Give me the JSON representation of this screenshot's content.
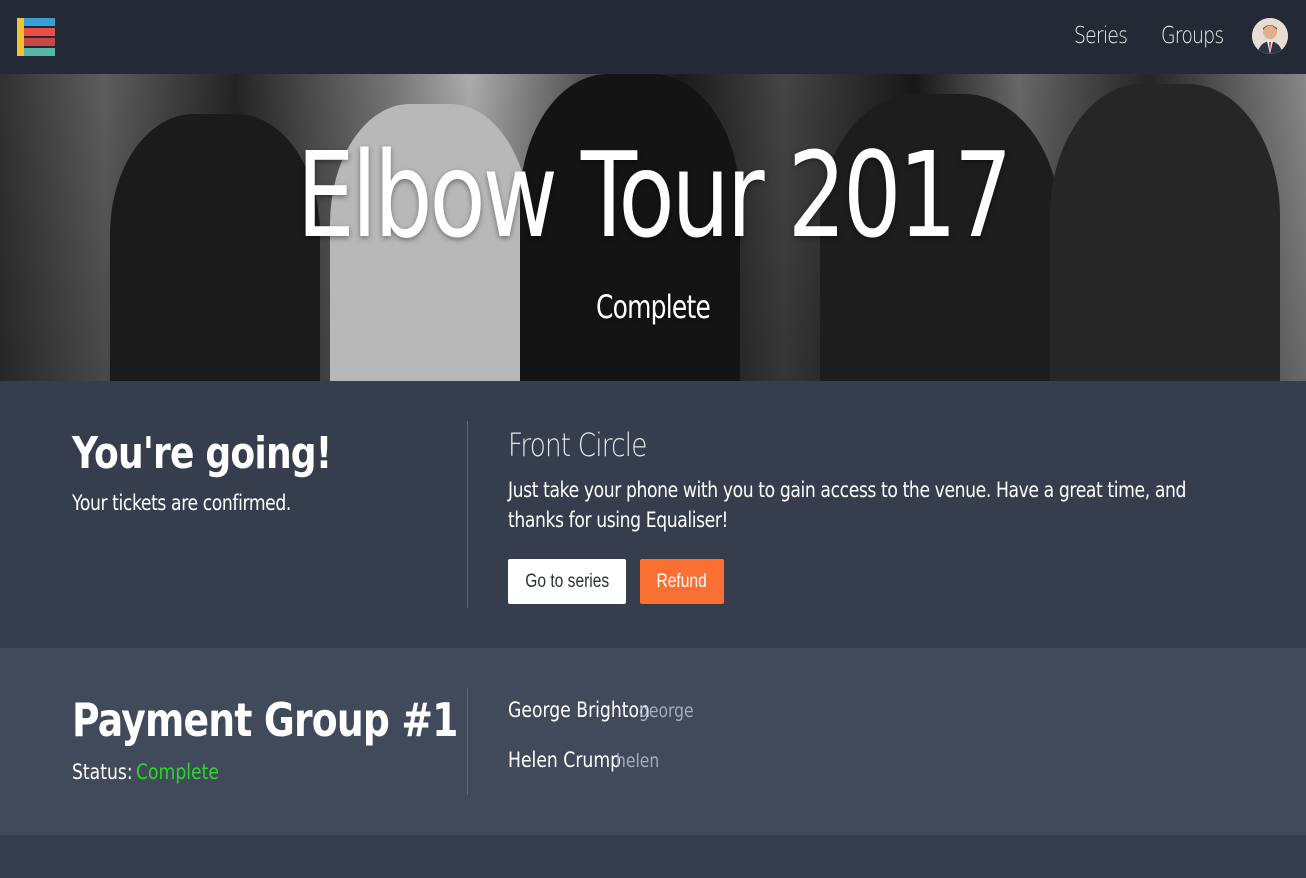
{
  "nav": {
    "links": [
      "Series",
      "Groups"
    ],
    "logo_colors": [
      "#e94e47",
      "#3b9fd6",
      "#58b8a8",
      "#f2c230"
    ]
  },
  "hero": {
    "title": "Elbow Tour 2017",
    "status": "Complete"
  },
  "ticket": {
    "heading": "You're going!",
    "subtext": "Your tickets are confirmed.",
    "tier": "Front Circle",
    "description": "Just take your phone with you to gain access to the venue. Have a great time, and thanks for using Equaliser!",
    "buttons": {
      "series": "Go to series",
      "refund": "Refund"
    }
  },
  "payment_group": {
    "heading": "Payment Group #1",
    "status_label": "Status:",
    "status_value": "Complete",
    "members": [
      {
        "name": "George Brighton",
        "username": "george"
      },
      {
        "name": "Helen Crump",
        "username": "helen"
      }
    ]
  },
  "colors": {
    "navbar": "#232a35",
    "section_dark": "#363d4d",
    "section_light": "#414a5b",
    "refund_button": "#fa7032",
    "status_complete": "#2fd42f"
  }
}
